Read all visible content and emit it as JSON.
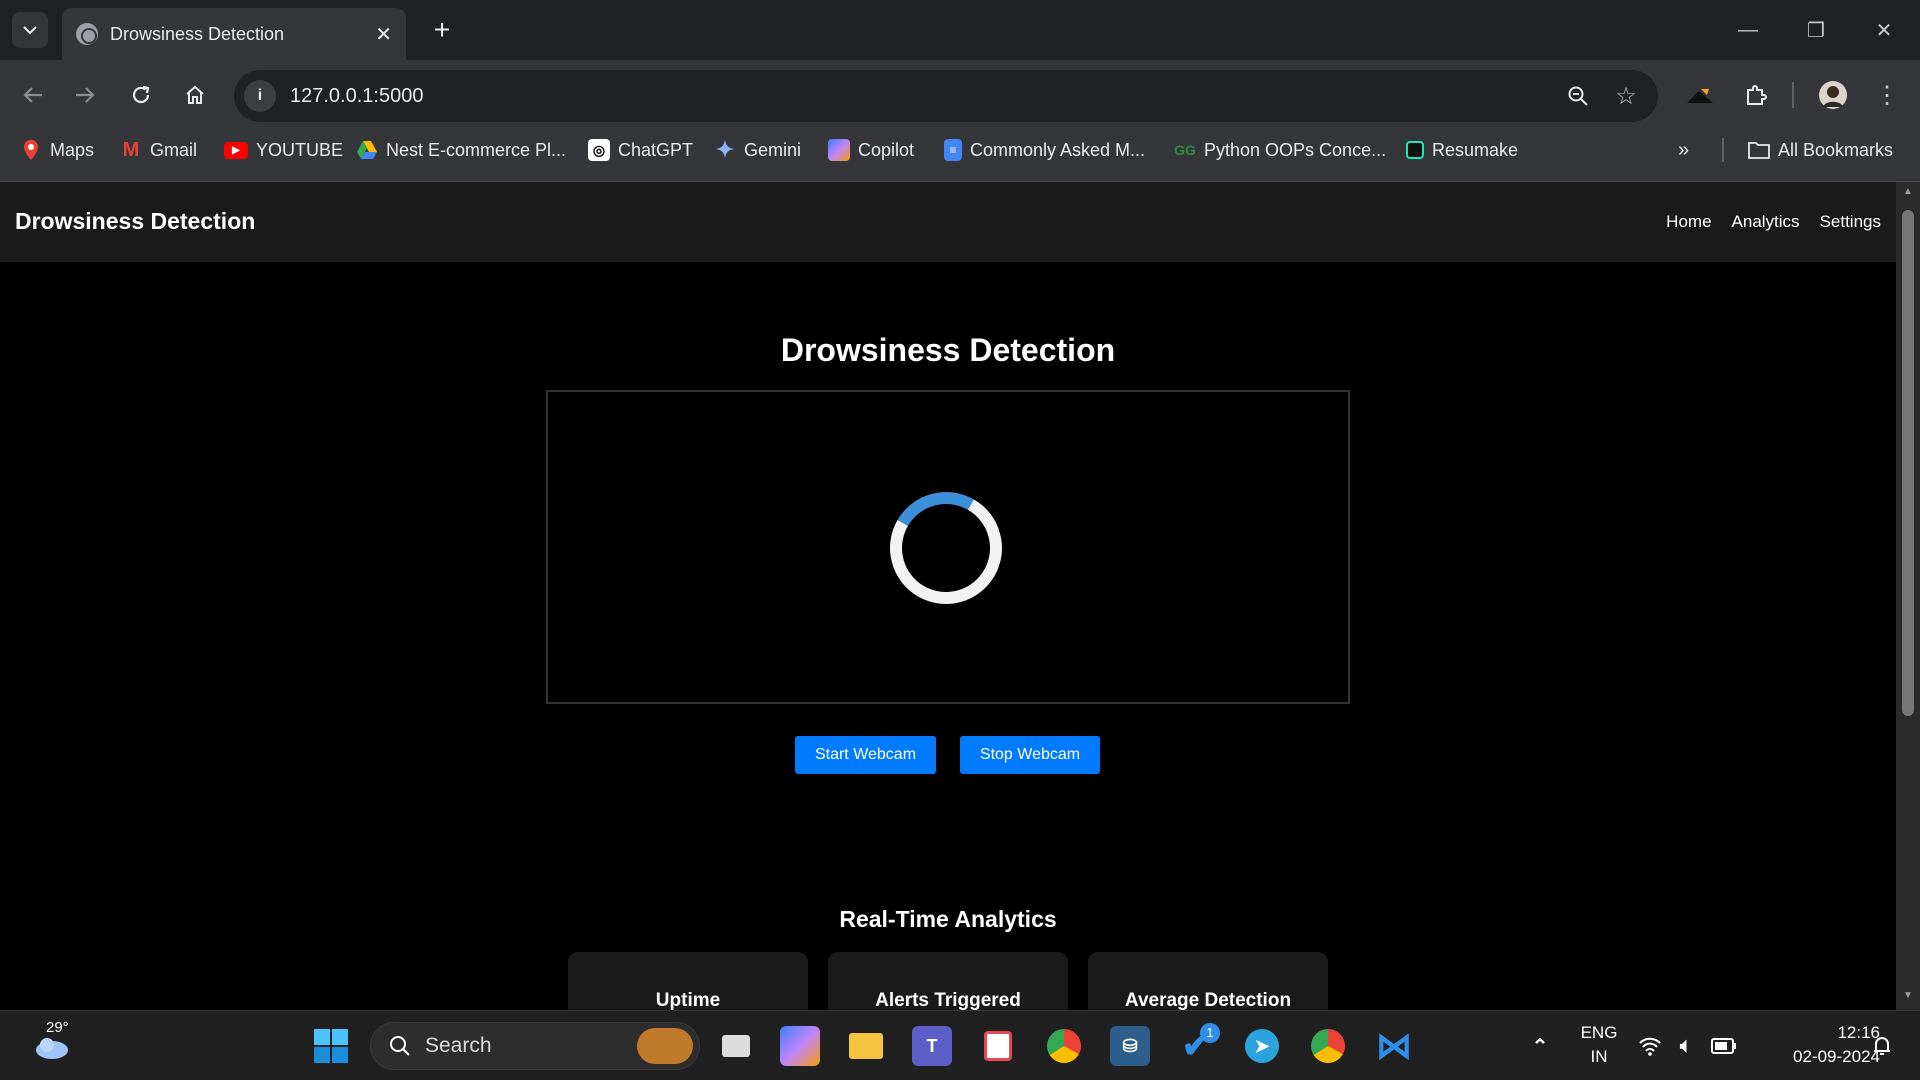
{
  "browser": {
    "tab_title": "Drowsiness Detection",
    "url": "127.0.0.1:5000",
    "bookmarks": [
      {
        "label": "Maps",
        "icon": "maps-icon",
        "color": "#34a853"
      },
      {
        "label": "Gmail",
        "icon": "gmail-icon",
        "color": "#ea4335"
      },
      {
        "label": "YOUTUBE",
        "icon": "youtube-icon",
        "color": "#ff0000"
      },
      {
        "label": "Nest E-commerce Pl...",
        "icon": "drive-icon",
        "color": "#fbbc04"
      },
      {
        "label": "ChatGPT",
        "icon": "chatgpt-icon",
        "color": "#ffffff"
      },
      {
        "label": "Gemini",
        "icon": "gemini-icon",
        "color": "#8ab4f8"
      },
      {
        "label": "Copilot",
        "icon": "copilot-icon",
        "color": "#c084fc"
      },
      {
        "label": "Commonly Asked M...",
        "icon": "docs-icon",
        "color": "#4285f4"
      },
      {
        "label": "Python OOPs Conce...",
        "icon": "gfg-icon",
        "color": "#2f8d46"
      },
      {
        "label": "Resumake",
        "icon": "resumake-icon",
        "color": "#1de9b6"
      }
    ],
    "all_bookmarks": "All Bookmarks"
  },
  "site": {
    "brand": "Drowsiness Detection",
    "nav": [
      "Home",
      "Analytics",
      "Settings"
    ],
    "title": "Drowsiness Detection",
    "start_button": "Start Webcam",
    "stop_button": "Stop Webcam",
    "analytics_title": "Real-Time Analytics",
    "cards": [
      "Uptime",
      "Alerts Triggered",
      "Average Detection"
    ],
    "accent_color": "#007bff"
  },
  "taskbar": {
    "weather_temp": "29°",
    "search_label": "Search",
    "language": "ENG",
    "region": "IN",
    "time": "12:16",
    "date": "02-09-2024",
    "badge_count": "1"
  }
}
